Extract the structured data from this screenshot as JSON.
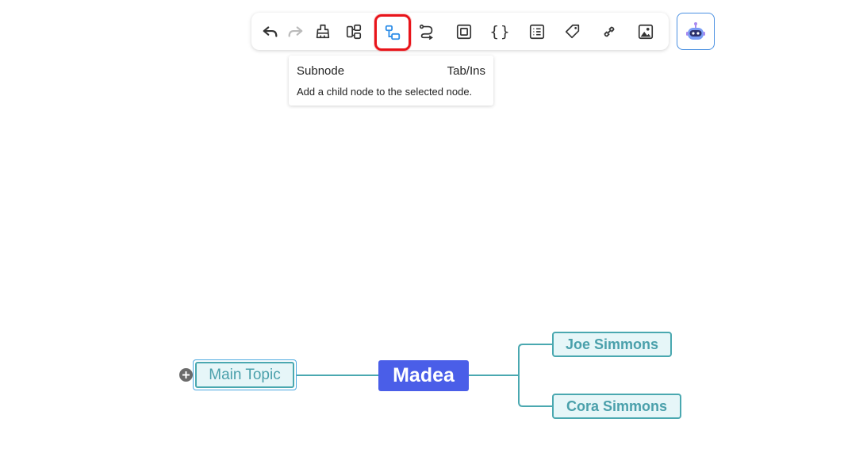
{
  "toolbar": {
    "buttons": [
      {
        "name": "undo",
        "icon": "undo-icon"
      },
      {
        "name": "redo",
        "icon": "redo-icon"
      },
      {
        "name": "format-painter",
        "icon": "brush-icon"
      },
      {
        "name": "sibling-node",
        "icon": "sibling-node-icon"
      },
      {
        "name": "subnode",
        "icon": "subnode-icon",
        "active": true
      },
      {
        "name": "relationship",
        "icon": "relationship-icon"
      },
      {
        "name": "boundary",
        "icon": "boundary-icon"
      },
      {
        "name": "summary",
        "icon": "braces-icon",
        "glyph": "{}"
      },
      {
        "name": "note",
        "icon": "note-icon"
      },
      {
        "name": "tag",
        "icon": "tag-icon"
      },
      {
        "name": "link",
        "icon": "link-icon"
      },
      {
        "name": "image",
        "icon": "image-icon"
      }
    ],
    "highlight_color": "#e8141a"
  },
  "ai_button": {
    "icon": "robot-icon"
  },
  "tooltip": {
    "title": "Subnode",
    "shortcut": "Tab/Ins",
    "description": "Add a child node to the selected node."
  },
  "mindmap": {
    "root": {
      "label": "Madea",
      "color": "#4a5ee8"
    },
    "left_node": {
      "label": "Main Topic"
    },
    "right_children": [
      {
        "label": "Joe Simmons"
      },
      {
        "label": "Cora Simmons"
      }
    ],
    "line_color": "#4aa8b0"
  }
}
